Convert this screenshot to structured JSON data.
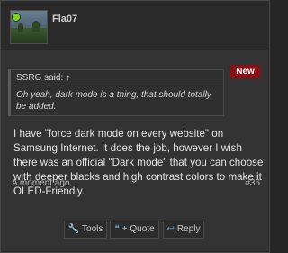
{
  "post": {
    "username": "Fla07",
    "new_badge": "New",
    "quote": {
      "author": "SSRG said:",
      "arrow": "↑",
      "text": "Oh yeah, dark mode is a thing, that should totally be added."
    },
    "message": "I have \"force dark mode on every website\" on Samsung Internet. It does the job, however I wish there was an official \"Dark mode\" that you can choose with deeper blacks and high contrast colors to make it OLED-Friendly.",
    "timestamp": "A moment ago",
    "post_number": "#36"
  },
  "actions": {
    "tools_label": "Tools",
    "quote_label": "+ Quote",
    "reply_label": "Reply"
  },
  "colors": {
    "accent": "#5e9ad6",
    "badge": "#8b1014",
    "online": "#7fd12a"
  },
  "icons": {
    "tools": "wrench-icon",
    "quote": "quote-icon",
    "reply": "reply-arrow-icon"
  }
}
